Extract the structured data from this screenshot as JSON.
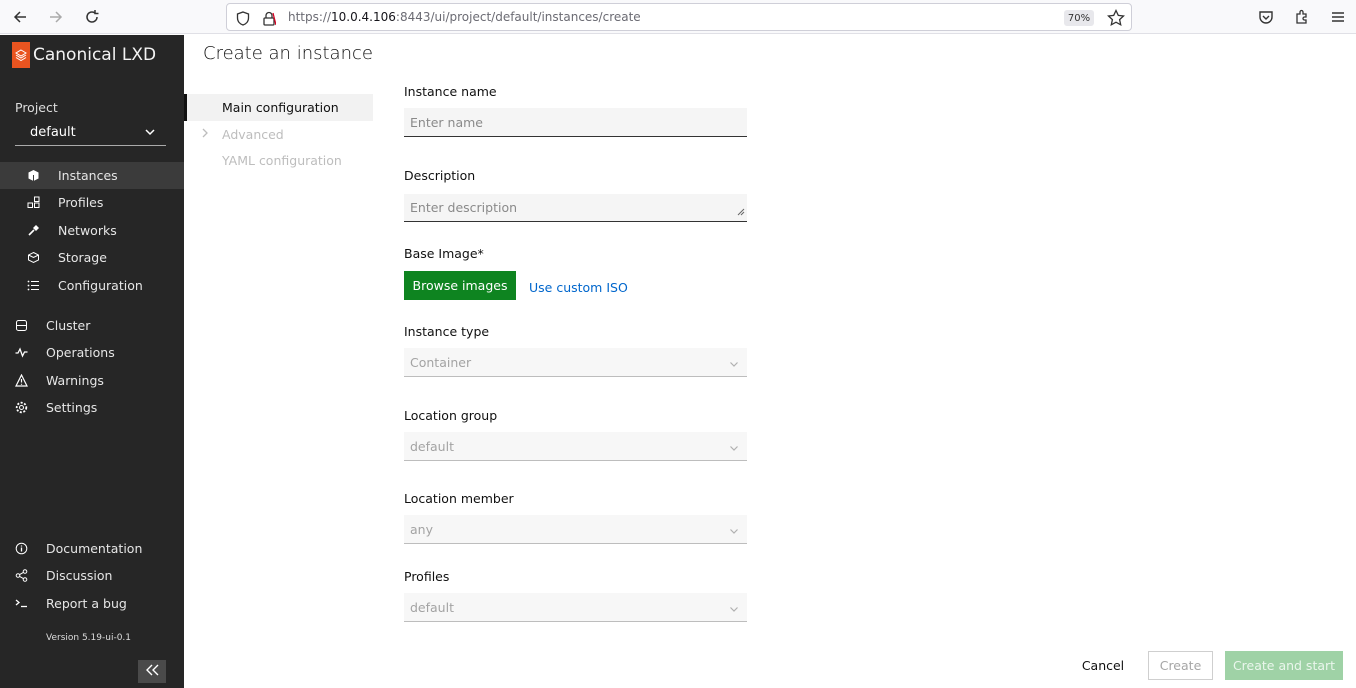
{
  "browser": {
    "url_prefix": "https://",
    "url_host": "10.0.4.106",
    "url_rest": ":8443/ui/project/default/instances/create",
    "zoom": "70%"
  },
  "sidebar": {
    "brand": "Canonical LXD",
    "project_label": "Project",
    "project_value": "default",
    "items": [
      {
        "label": "Instances",
        "icon": "instances-icon"
      },
      {
        "label": "Profiles",
        "icon": "profiles-icon"
      },
      {
        "label": "Networks",
        "icon": "networks-icon"
      },
      {
        "label": "Storage",
        "icon": "storage-icon"
      },
      {
        "label": "Configuration",
        "icon": "configuration-icon"
      },
      {
        "label": "Cluster",
        "icon": "cluster-icon"
      },
      {
        "label": "Operations",
        "icon": "operations-icon"
      },
      {
        "label": "Warnings",
        "icon": "warnings-icon"
      },
      {
        "label": "Settings",
        "icon": "settings-icon"
      }
    ],
    "bottom_items": [
      {
        "label": "Documentation",
        "icon": "documentation-icon"
      },
      {
        "label": "Discussion",
        "icon": "discussion-icon"
      },
      {
        "label": "Report a bug",
        "icon": "report-bug-icon"
      }
    ],
    "version": "Version 5.19-ui-0.1"
  },
  "main": {
    "title": "Create an instance",
    "side_nav": [
      "Main configuration",
      "Advanced",
      "YAML configuration"
    ],
    "form": {
      "instance_name_label": "Instance name",
      "instance_name_placeholder": "Enter name",
      "description_label": "Description",
      "description_placeholder": "Enter description",
      "base_image_label": "Base Image*",
      "browse_images": "Browse images",
      "use_custom_iso": "Use custom ISO",
      "instance_type_label": "Instance type",
      "instance_type_value": "Container",
      "location_group_label": "Location group",
      "location_group_value": "default",
      "location_member_label": "Location member",
      "location_member_value": "any",
      "profiles_label": "Profiles",
      "profiles_value": "default"
    },
    "footer": {
      "cancel": "Cancel",
      "create": "Create",
      "create_and_start": "Create and start"
    }
  },
  "colors": {
    "sidebar_bg": "#262626",
    "primary_green": "#0e8420",
    "link_blue": "#0066cc",
    "brand_orange": "#e95420"
  }
}
